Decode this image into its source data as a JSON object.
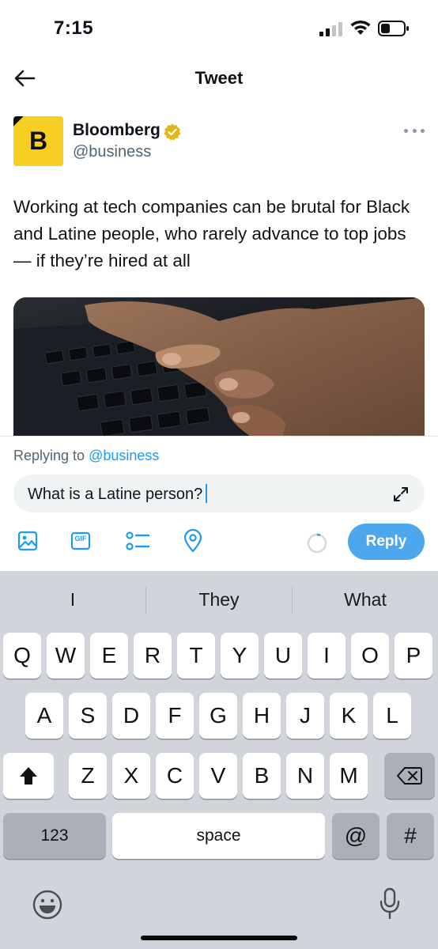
{
  "status_bar": {
    "time": "7:15"
  },
  "header": {
    "title": "Tweet"
  },
  "tweet": {
    "author_name": "Bloomberg",
    "author_handle": "@business",
    "avatar_letter": "B",
    "text": "Working at tech companies can be brutal for Black and Latine people, who rarely advance to top jobs — if they’re hired at all"
  },
  "reply": {
    "replying_prefix": "Replying to",
    "replying_handle": "@business",
    "input_value": "What is a Latine person?",
    "button_label": "Reply",
    "tools": [
      "image-icon",
      "gif-icon",
      "poll-icon",
      "location-icon"
    ],
    "gif_label": "GIF"
  },
  "keyboard": {
    "suggestions": [
      "I",
      "They",
      "What"
    ],
    "row1": [
      "Q",
      "W",
      "E",
      "R",
      "T",
      "Y",
      "U",
      "I",
      "O",
      "P"
    ],
    "row2": [
      "A",
      "S",
      "D",
      "F",
      "G",
      "H",
      "J",
      "K",
      "L"
    ],
    "row3": [
      "Z",
      "X",
      "C",
      "V",
      "B",
      "N",
      "M"
    ],
    "numbers_label": "123",
    "space_label": "space",
    "at_label": "@",
    "hash_label": "#"
  },
  "colors": {
    "accent": "#1d9bf0",
    "reply_button": "#4ca7ee",
    "verified": "#e2b719",
    "keyboard_bg": "#d1d4da"
  }
}
